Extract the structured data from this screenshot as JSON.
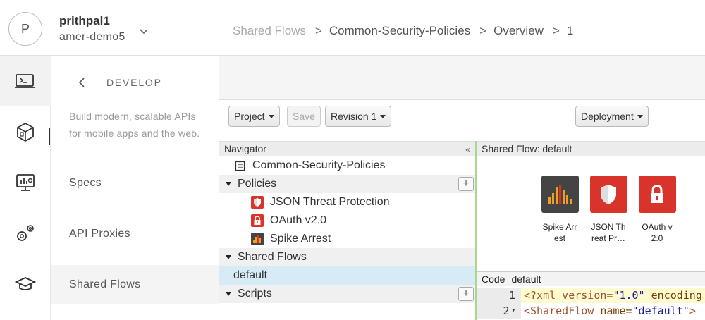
{
  "header": {
    "avatar_letter": "P",
    "user_name": "prithpal1",
    "org_name": "amer-demo5",
    "breadcrumb": [
      "Shared Flows",
      "Common-Security-Policies",
      "Overview",
      "1"
    ],
    "breadcrumb_sep": ">"
  },
  "rail": {
    "items": [
      {
        "icon": "terminal-icon",
        "active": true
      },
      {
        "icon": "package-icon",
        "active": false
      },
      {
        "icon": "monitor-chart-icon",
        "active": false
      },
      {
        "icon": "gears-icon",
        "active": false
      },
      {
        "icon": "graduation-cap-icon",
        "active": false
      }
    ]
  },
  "sidenav": {
    "title": "DEVELOP",
    "description": "Build modern, scalable APIs for mobile apps and the web.",
    "items": [
      {
        "label": "Specs",
        "active": false
      },
      {
        "label": "API Proxies",
        "active": false
      },
      {
        "label": "Shared Flows",
        "active": true
      }
    ]
  },
  "toolbar": {
    "project_label": "Project",
    "save_label": "Save",
    "revision_label": "Revision 1",
    "deployment_label": "Deployment"
  },
  "navigator": {
    "title": "Navigator",
    "collapse_symbol": "«",
    "root": "Common-Security-Policies",
    "policies_label": "Policies",
    "policies": [
      {
        "label": "JSON Threat Protection",
        "icon": "shield-icon",
        "color": "#d9342b"
      },
      {
        "label": "OAuth v2.0",
        "icon": "lock-icon",
        "color": "#d9342b"
      },
      {
        "label": "Spike Arrest",
        "icon": "spike-bars-icon",
        "color": "#444444"
      }
    ],
    "shared_flows_label": "Shared Flows",
    "shared_flows": [
      {
        "label": "default"
      }
    ],
    "scripts_label": "Scripts",
    "plus_symbol": "+"
  },
  "flow": {
    "title": "Shared Flow: default",
    "policies": [
      {
        "label": "Spike Arr est",
        "icon": "spike-bars-icon",
        "color": "#444444"
      },
      {
        "label": "JSON Th reat Pr…",
        "icon": "shield-icon",
        "color": "#d9342b"
      },
      {
        "label": "OAuth v 2.0",
        "icon": "lock-icon",
        "color": "#d9342b"
      }
    ],
    "code_tab": "Code",
    "code_name": "default",
    "code_lines": [
      {
        "num": "1",
        "xml_open": "<?xml version=",
        "xml_version": "\"1.0\"",
        "xml_rest": " encoding"
      },
      {
        "num": "2",
        "tag_open": "<SharedFlow ",
        "attr": "name=",
        "attr_val": "\"default\"",
        "tag_close": ">"
      }
    ]
  },
  "colors": {
    "accent_splitter": "#a8d98a",
    "selected_row": "#d7ebf7",
    "policy_red": "#d9342b",
    "policy_dark": "#444444"
  }
}
